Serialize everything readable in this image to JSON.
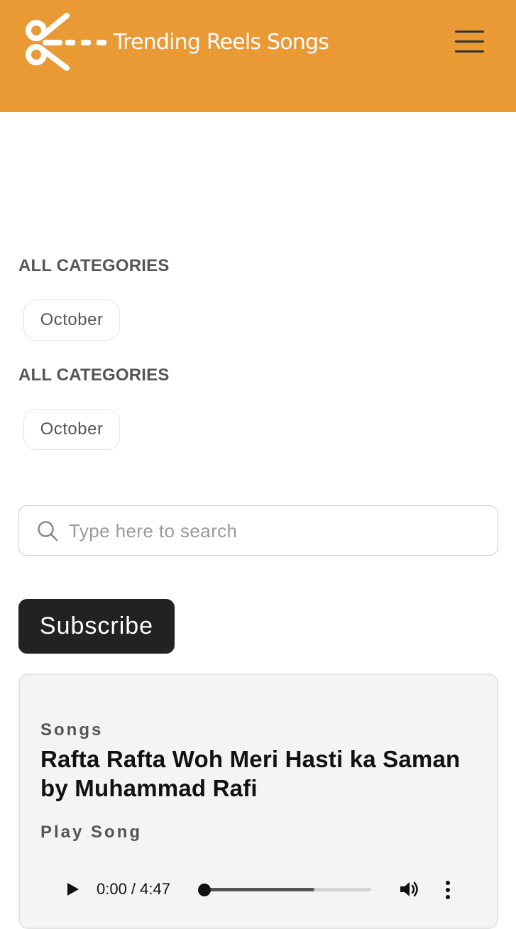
{
  "header": {
    "site_name": "Trending Reels Songs",
    "background_color": "#e99a35"
  },
  "categories_blocks": [
    {
      "heading": "ALL CATEGORIES",
      "items": [
        "October"
      ]
    },
    {
      "heading": "ALL CATEGORIES",
      "items": [
        "October"
      ]
    }
  ],
  "search": {
    "placeholder": "Type here to search",
    "value": ""
  },
  "subscribe": {
    "label": "Subscribe"
  },
  "post": {
    "category": "Songs",
    "title": "Rafta Rafta Woh Meri Hasti ka Saman by Muhammad Rafi",
    "play_label": "Play Song",
    "player": {
      "current_time": "0:00",
      "separator": "/",
      "duration": "4:47",
      "time_text": "0:00 / 4:47",
      "progress": 0.0,
      "buffered": 0.66
    }
  },
  "icons": {
    "logo": "scissors-logo-icon",
    "menu": "hamburger-menu-icon",
    "search": "search-icon",
    "play": "play-icon",
    "volume": "volume-icon",
    "more": "more-vertical-icon"
  }
}
